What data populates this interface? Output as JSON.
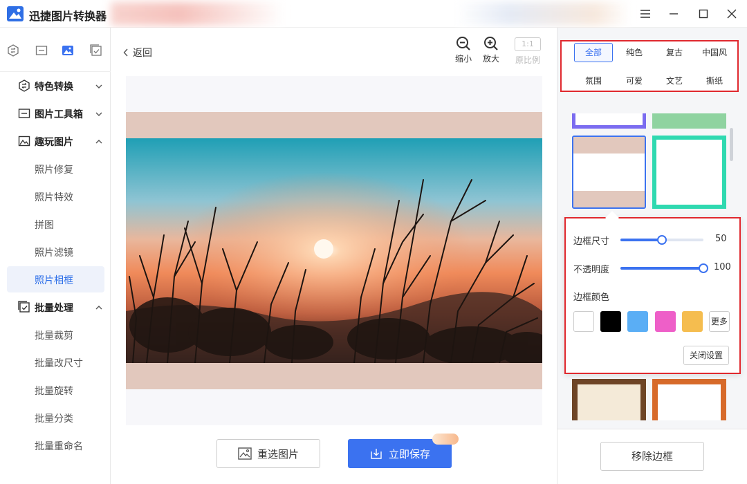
{
  "app": {
    "title": "迅捷图片转换器"
  },
  "sidebar": {
    "groups": [
      {
        "label": "特色转换"
      },
      {
        "label": "图片工具箱"
      },
      {
        "label": "趣玩图片",
        "items": [
          "照片修复",
          "照片特效",
          "拼图",
          "照片滤镜",
          "照片相框"
        ]
      },
      {
        "label": "批量处理",
        "items": [
          "批量裁剪",
          "批量改尺寸",
          "批量旋转",
          "批量分类",
          "批量重命名"
        ]
      }
    ],
    "active_item": "照片相框"
  },
  "toolbar": {
    "back_label": "返回",
    "zoom_out_label": "缩小",
    "zoom_in_label": "放大",
    "ratio_box": "1:1",
    "ratio_label": "原比例"
  },
  "actions": {
    "reselect_label": "重选图片",
    "save_label": "立即保存"
  },
  "right_panel": {
    "filters": [
      "全部",
      "纯色",
      "复古",
      "中国风",
      "氛围",
      "可爱",
      "文艺",
      "撕纸"
    ],
    "active_filter": "全部",
    "settings": {
      "border_size_label": "边框尺寸",
      "border_size_value": "50",
      "border_size_fraction": 0.5,
      "opacity_label": "不透明度",
      "opacity_value": "100",
      "opacity_fraction": 1.0,
      "color_label": "边框颜色",
      "colors": [
        "#ffffff",
        "#000000",
        "#5aaef5",
        "#ee5fc8",
        "#f5bd4f"
      ],
      "more_label": "更多",
      "close_label": "关闭设置"
    },
    "remove_label": "移除边框"
  },
  "colors": {
    "accent": "#3b72f0",
    "frame": "#e2c8bd",
    "highlight_box": "#e0282e"
  }
}
